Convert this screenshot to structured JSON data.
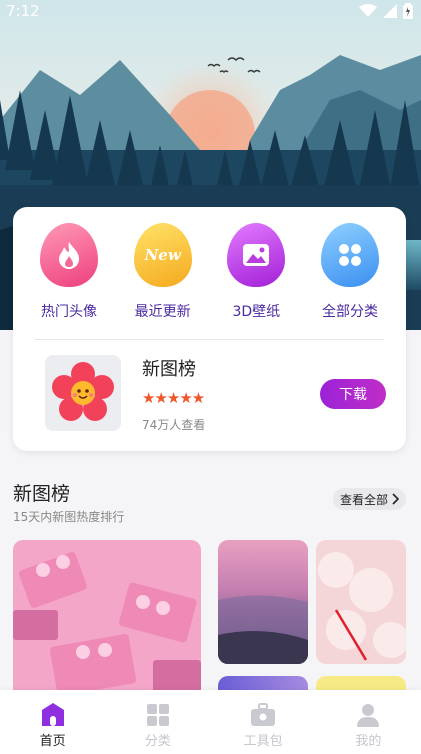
{
  "status_bar": {
    "time": "7:12"
  },
  "categories": [
    {
      "label": "热门头像",
      "icon": "flame-icon"
    },
    {
      "label": "最近更新",
      "icon": "new-badge-icon",
      "badge": "New"
    },
    {
      "label": "3D壁纸",
      "icon": "image-icon"
    },
    {
      "label": "全部分类",
      "icon": "grid-icon"
    }
  ],
  "feature": {
    "title": "新图榜",
    "rating": "★★★★★",
    "views": "74万人查看",
    "download_label": "下载"
  },
  "section": {
    "title": "新图榜",
    "subtitle": "15天内新图热度排行",
    "see_all": "查看全部"
  },
  "tabs": [
    {
      "label": "首页",
      "icon": "home-icon",
      "active": true
    },
    {
      "label": "分类",
      "icon": "category-icon",
      "active": false
    },
    {
      "label": "工具包",
      "icon": "toolbox-icon",
      "active": false
    },
    {
      "label": "我的",
      "icon": "profile-icon",
      "active": false
    }
  ],
  "colors": {
    "accent": "#a326d2",
    "label": "#4a2aa0",
    "star": "#f0572c"
  }
}
